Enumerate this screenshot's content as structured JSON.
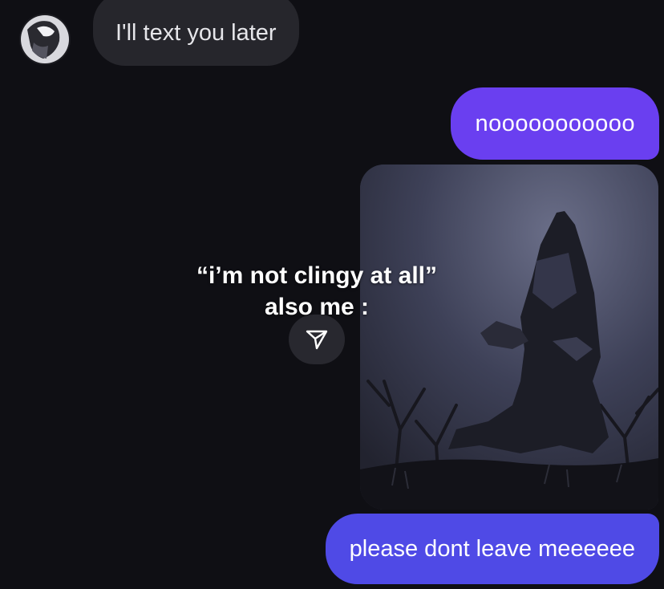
{
  "conversation": {
    "messages": [
      {
        "sender": "other",
        "type": "text",
        "text": "I'll text you later"
      },
      {
        "sender": "me",
        "type": "text",
        "text": "nooooooooooo"
      },
      {
        "sender": "me",
        "type": "image",
        "caption_line_1": "“i’m not clingy at all”",
        "caption_line_2": "also me :"
      },
      {
        "sender": "me",
        "type": "text",
        "text": "please dont leave meeeeee"
      }
    ]
  },
  "icons": {
    "avatar": "profile-avatar",
    "share": "paper-plane-icon"
  },
  "colors": {
    "background": "#0f0f14",
    "received_bubble": "#26262c",
    "sent_bubble_purple": "#6a3ff0",
    "sent_bubble_blue": "#4f4ae6"
  }
}
